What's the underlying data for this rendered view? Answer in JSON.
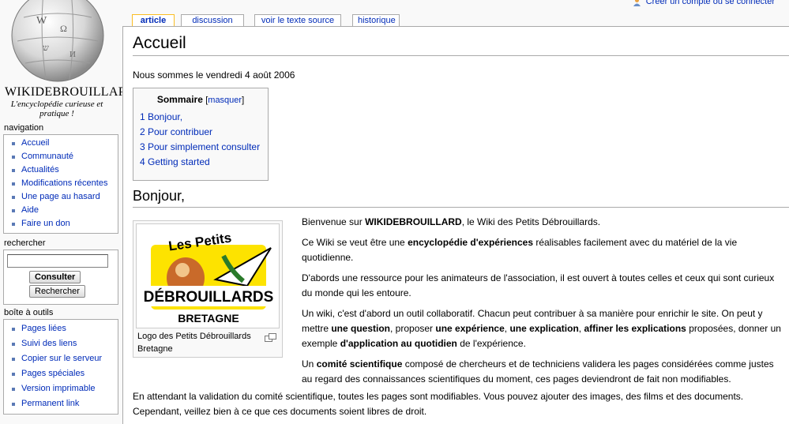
{
  "logo": {
    "wordmark": "WIKIDEBROUILLARD",
    "tagline": "L'encyclopédie curieuse et pratique !"
  },
  "personal": {
    "create_account": "Créer un compte ou se connecter"
  },
  "tabs": [
    {
      "label": "article",
      "selected": true
    },
    {
      "label": "discussion",
      "selected": false
    },
    {
      "label": "voir le texte source",
      "selected": false
    },
    {
      "label": "historique",
      "selected": false
    }
  ],
  "navigation": {
    "title": "navigation",
    "items": [
      "Accueil",
      "Communauté",
      "Actualités",
      "Modifications récentes",
      "Une page au hasard",
      "Aide",
      "Faire un don"
    ]
  },
  "search": {
    "title": "rechercher",
    "value": "",
    "go_label": "Consulter",
    "search_label": "Rechercher"
  },
  "toolbox": {
    "title": "boîte à outils",
    "items": [
      "Pages liées",
      "Suivi des liens",
      "Copier sur le serveur",
      "Pages spéciales",
      "Version imprimable",
      "Permanent link"
    ]
  },
  "page": {
    "title": "Accueil",
    "date": "Nous sommes le vendredi 4 août 2006",
    "toc": {
      "title": "Sommaire",
      "hide_label": "masquer",
      "items": [
        "1 Bonjour,",
        "2 Pour contribuer",
        "3 Pour simplement consulter",
        "4 Getting started"
      ]
    },
    "section_title": "Bonjour,",
    "thumb": {
      "logo_top": "Les Petits",
      "logo_main": "DÉBROUILLARDS",
      "logo_bottom": "BRETAGNE",
      "caption": "Logo des Petits Débrouillards Bretagne"
    },
    "paragraphs": {
      "p1": {
        "a": "Bienvenue sur ",
        "b": "WIKIDEBROUILLARD",
        "c": ", le Wiki des Petits Débrouillards."
      },
      "p2": {
        "a": "Ce Wiki se veut être une ",
        "b": "encyclopédie d'expériences",
        "c": " réalisables facilement avec du matériel de la vie quotidienne."
      },
      "p3": "D'abords une ressource pour les animateurs de l'association, il est ouvert à toutes celles et ceux qui sont curieux du monde qui les entoure.",
      "p4": {
        "a": "Un wiki, c'est d'abord un outil collaboratif. Chacun peut contribuer à sa manière pour enrichir le site. On peut y mettre ",
        "b": "une question",
        "c": ", proposer ",
        "d": "une expérience",
        "e": ", ",
        "f": "une explication",
        "g": ", ",
        "h": "affiner les explications",
        "i": " proposées, donner un exemple ",
        "j": "d'application au quotidien",
        "k": " de l'expérience."
      },
      "p5": {
        "a": "Un ",
        "b": "comité scientifique",
        "c": " composé de chercheurs et de techniciens validera les pages considérées comme justes au regard des connaissances scientifiques du moment, ces pages deviendront de fait non modifiables."
      },
      "p6": "En attendant la validation du comité scientifique, toutes les pages sont modifiables. Vous pouvez ajouter des images, des films et des documents. Cependant, veillez bien à ce que ces documents soient libres de droit."
    }
  },
  "colors": {
    "link": "#002bb8",
    "tab_selected_border": "#fabd23",
    "bullet": "#5a79b5"
  }
}
